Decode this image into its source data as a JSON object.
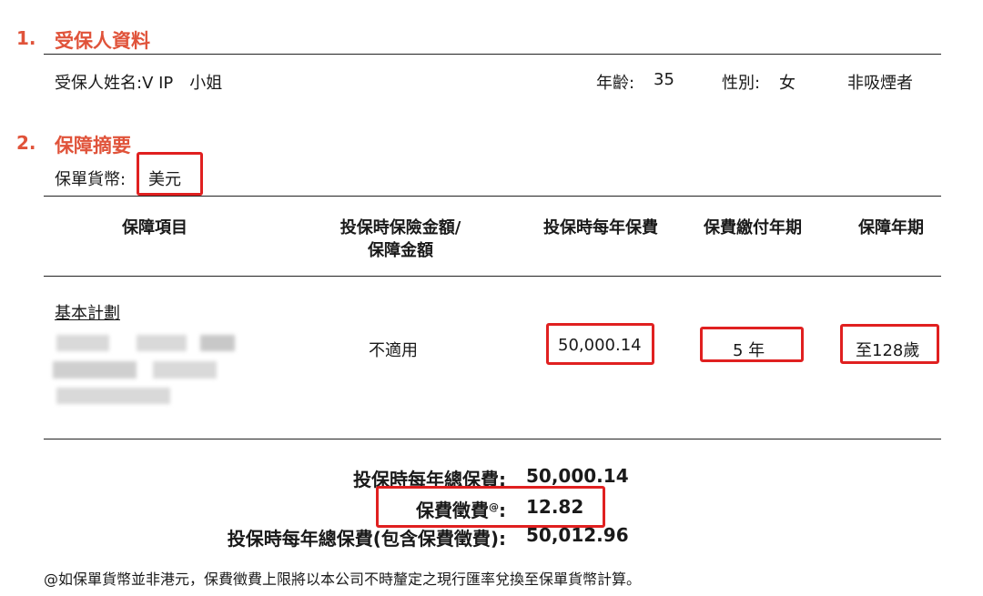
{
  "section1": {
    "number": "1.",
    "title": "受保人資料",
    "insured_name": "受保人姓名:V IP　小姐",
    "age_label": "年齡:",
    "age_value": "35",
    "gender_label": "性別:",
    "gender_value": "女",
    "smoker": "非吸煙者"
  },
  "section2": {
    "number": "2.",
    "title": "保障摘要",
    "currency_label": "保單貨幣:",
    "currency_value": "美元"
  },
  "table": {
    "headers": {
      "item": "保障項目",
      "sum_line1": "投保時保險金額/",
      "sum_line2": "保障金額",
      "annual_premium": "投保時每年保費",
      "payment_term": "保費繳付年期",
      "coverage_term": "保障年期"
    },
    "row": {
      "plan_label": "基本計劃",
      "sum_insured": "不適用",
      "annual_premium": "50,000.14",
      "payment_term": "5 年",
      "coverage_term": "至128歲"
    }
  },
  "summary": {
    "total_label": "投保時每年總保費:",
    "total_value": "50,000.14",
    "levy_label": "保費徵費",
    "levy_sup": "@",
    "levy_colon": ":",
    "levy_value": "12.82",
    "total_with_levy_label": "投保時每年總保費(包含保費徵費):",
    "total_with_levy_value": "50,012.96"
  },
  "footnote": "@如保單貨幣並非港元，保費徵費上限將以本公司不時釐定之現行匯率兌換至保單貨幣計算。",
  "colors": {
    "accent": "#e0533a",
    "highlight_box": "#e02020"
  }
}
